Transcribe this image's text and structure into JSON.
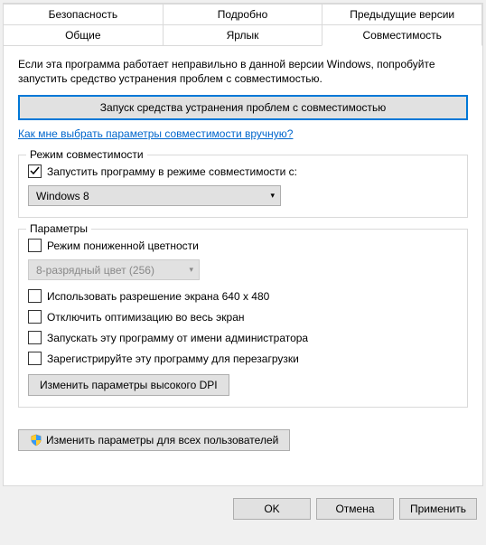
{
  "tabs_row1": [
    "Безопасность",
    "Подробно",
    "Предыдущие версии"
  ],
  "tabs_row2": [
    "Общие",
    "Ярлык",
    "Совместимость"
  ],
  "intro": "Если эта программа работает неправильно в данной версии Windows, попробуйте запустить средство устранения проблем с совместимостью.",
  "troubleshoot_btn": "Запуск средства устранения проблем с совместимостью",
  "help_link": "Как мне выбрать параметры совместимости вручную?",
  "compat_group": {
    "legend": "Режим совместимости",
    "checkbox_label": "Запустить программу в режиме совместимости с:",
    "selected": "Windows 8"
  },
  "params_group": {
    "legend": "Параметры",
    "reduced_color_label": "Режим пониженной цветности",
    "color_value": "8-разрядный цвет (256)",
    "res_640_label": "Использовать разрешение экрана 640 x 480",
    "disable_fullscreen_label": "Отключить оптимизацию во весь экран",
    "run_admin_label": "Запускать эту программу от имени администратора",
    "register_restart_label": "Зарегистрируйте эту программу для перезагрузки",
    "dpi_btn": "Изменить параметры высокого DPI"
  },
  "all_users_btn": "Изменить параметры для всех пользователей",
  "footer": {
    "ok": "OK",
    "cancel": "Отмена",
    "apply": "Применить"
  }
}
